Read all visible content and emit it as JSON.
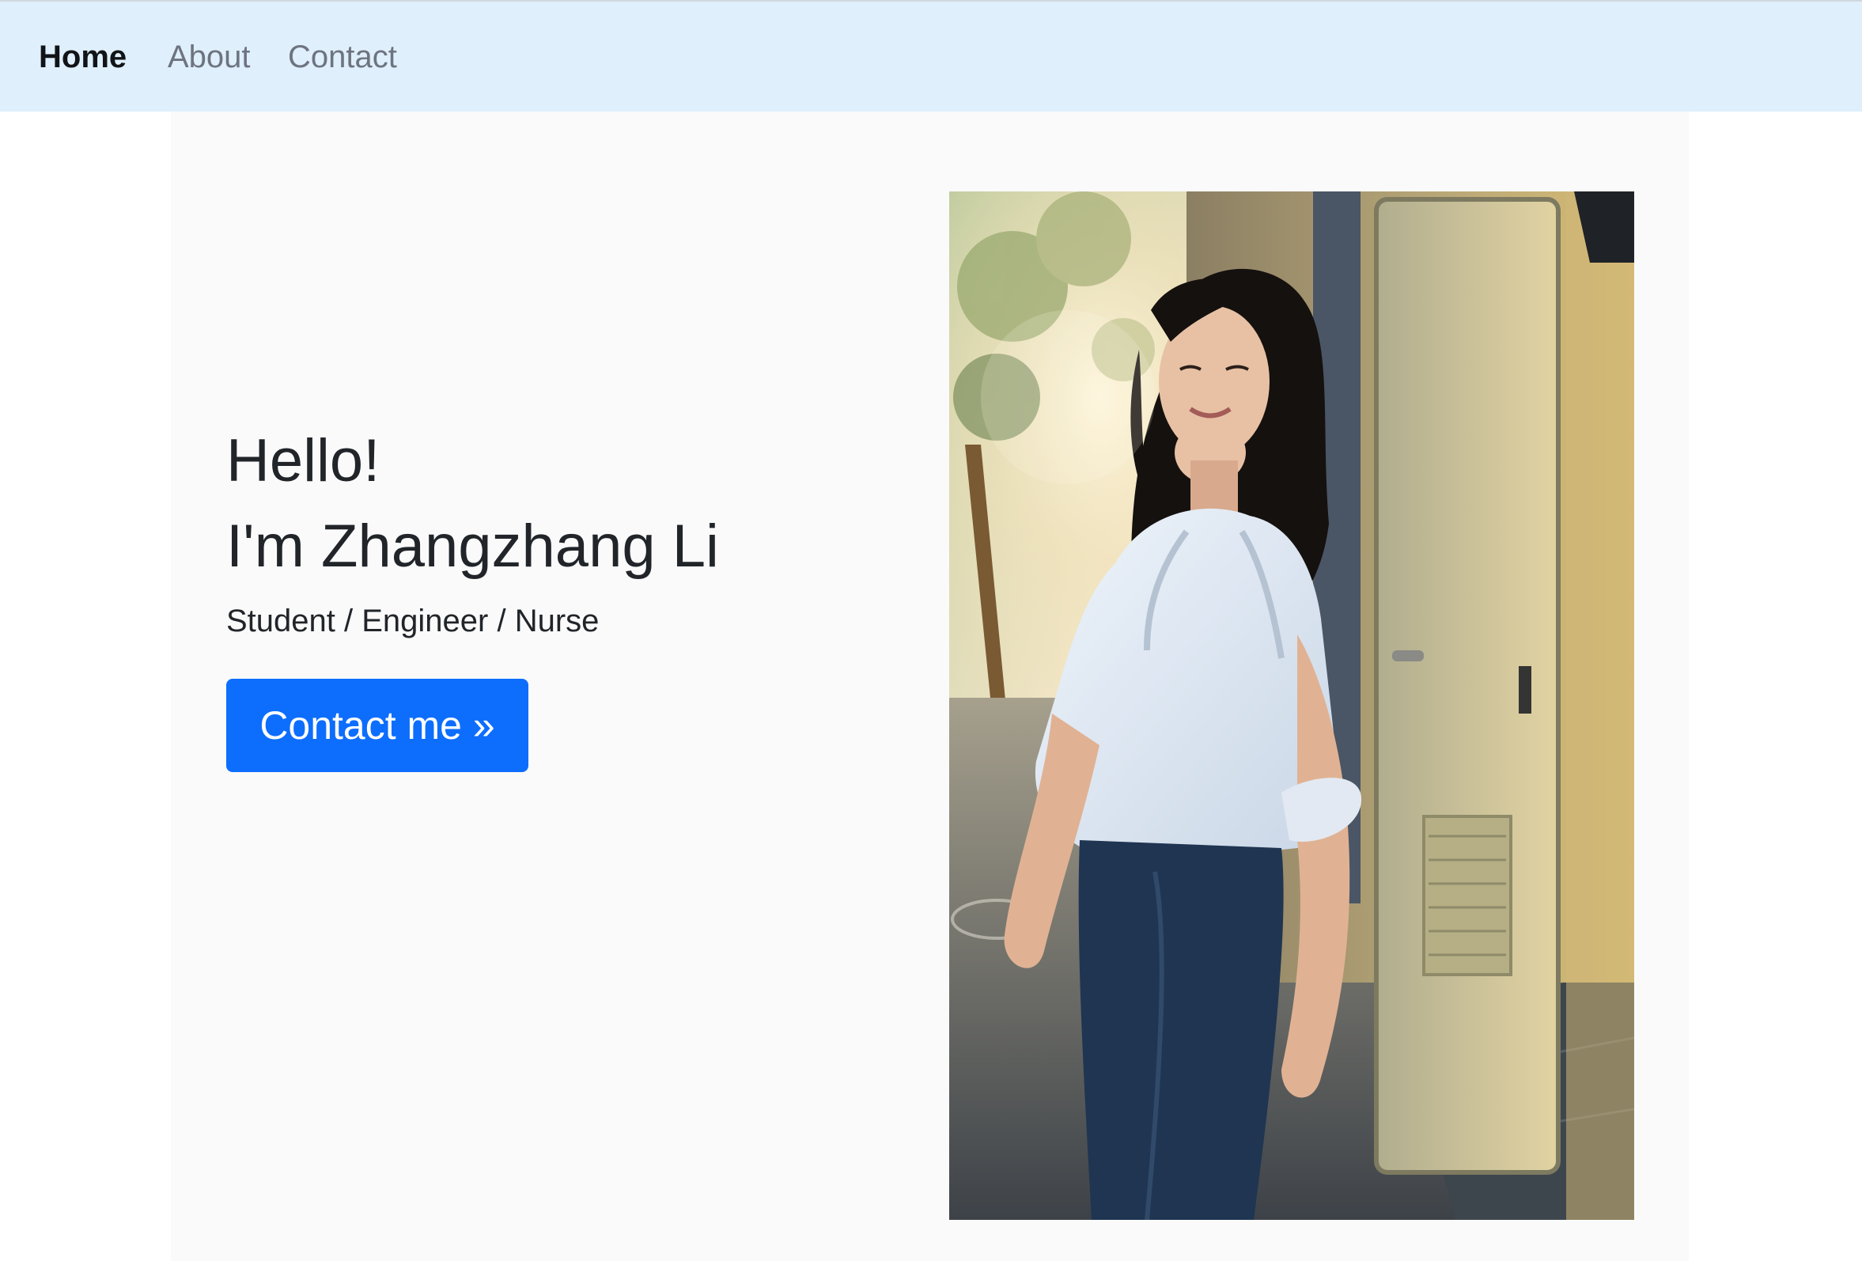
{
  "navbar": {
    "items": [
      {
        "label": "Home",
        "active": true
      },
      {
        "label": "About",
        "active": false
      },
      {
        "label": "Contact",
        "active": false
      }
    ]
  },
  "hero": {
    "greeting": "Hello!",
    "name": "I'm Zhangzhang Li",
    "roles": "Student / Engineer / Nurse",
    "cta_label": "Contact me »"
  },
  "colors": {
    "navbar_bg": "#dfeffb",
    "hero_bg": "#fafafa",
    "accent": "#0d6efd"
  }
}
